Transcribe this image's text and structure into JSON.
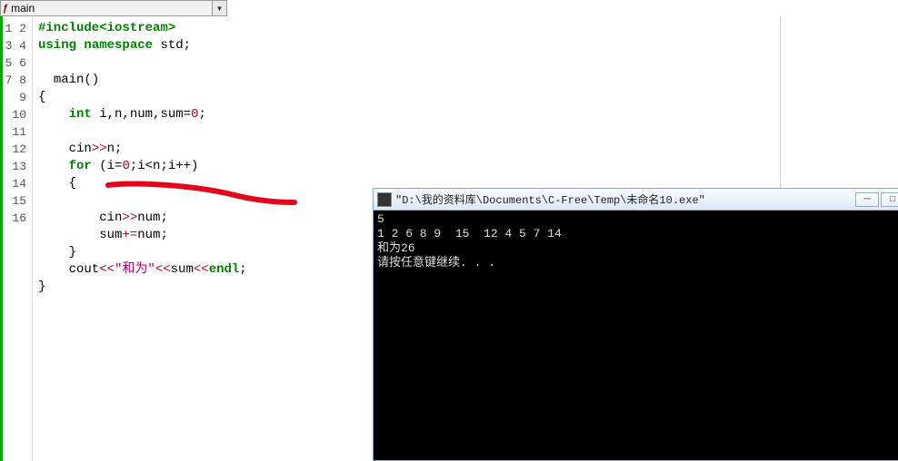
{
  "dropdown": {
    "icon": "ƒ",
    "label": "main"
  },
  "code": {
    "lines": [
      1,
      2,
      3,
      4,
      5,
      6,
      7,
      8,
      9,
      10,
      11,
      12,
      13,
      14,
      15,
      16
    ],
    "l1": {
      "include": "#include",
      "hdr": "<iostream>"
    },
    "l2": {
      "using": "using",
      "ns": "namespace",
      "std": "std",
      ";": ";"
    },
    "l4": {
      "main": "main",
      "par": "()"
    },
    "l5": "{",
    "l6": {
      "int": "int",
      "vars": " i,n,num,sum=",
      "zero": "0",
      "sc": ";"
    },
    "l8": {
      "cin": "cin",
      "op": ">>",
      "n": "n;"
    },
    "l9": {
      "for": "for",
      "open": " (i=",
      "z": "0",
      "cond": ";i<n;i++)"
    },
    "l10": "    {",
    "l12": {
      "pad": "        cin",
      "op": ">>",
      "v": "num;"
    },
    "l13": {
      "pad": "        sum",
      "op": "+=",
      "v": "num;"
    },
    "l14": "    }",
    "l15": {
      "cout": "    cout",
      "op1": "<<",
      "str": "\"和为\"",
      "op2": "<<",
      "v": "sum",
      "op3": "<<",
      "endl": "endl",
      "sc": ";"
    },
    "l16": "}"
  },
  "console": {
    "title": "\"D:\\我的资料库\\Documents\\C-Free\\Temp\\未命名10.exe\"",
    "out1": "5",
    "out2": "1 2 6 8 9  15  12 4 5 7 14",
    "out3": "和为26",
    "out4": "请按任意键继续. . ."
  },
  "winbtns": {
    "min": "─",
    "max": "□",
    "close": "✕"
  }
}
